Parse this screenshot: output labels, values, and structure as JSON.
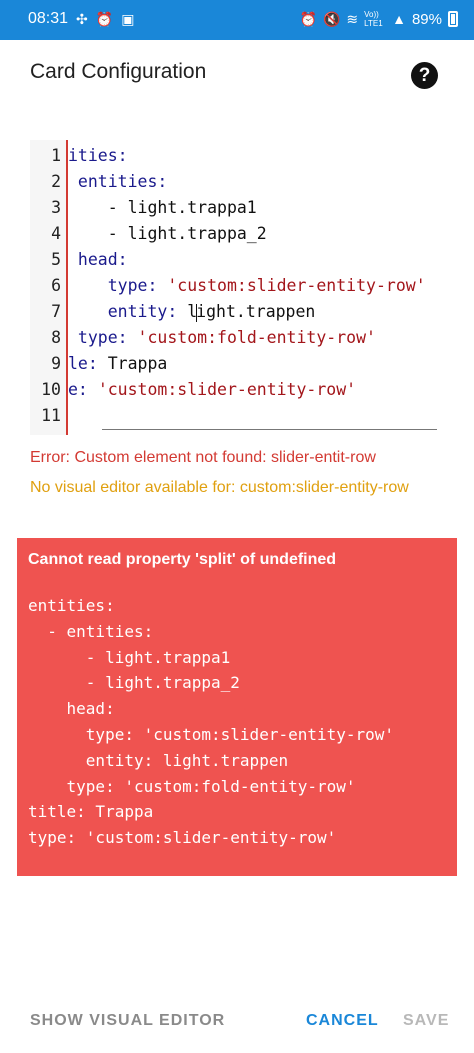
{
  "status_bar": {
    "time": "08:31",
    "battery": "89%",
    "left_icons": [
      "pinwheel-icon",
      "alarm-icon",
      "image-icon"
    ],
    "right_icons": [
      "alarm-icon",
      "mute-icon",
      "wifi-icon",
      "volte-icon",
      "signal-icon"
    ],
    "volte_text": "Vo)) LTE1"
  },
  "dialog": {
    "title": "Card Configuration",
    "help_icon": "help-icon"
  },
  "editor": {
    "line_numbers": [
      "1",
      "2",
      "3",
      "4",
      "5",
      "6",
      "7",
      "8",
      "9",
      "10",
      "11"
    ],
    "lines": [
      {
        "key": "ities:",
        "value": ""
      },
      {
        "key": " entities:",
        "value": ""
      },
      {
        "key": "    - light.trappa1",
        "value": ""
      },
      {
        "key": "    - light.trappa_2",
        "value": ""
      },
      {
        "key": " head:",
        "value": ""
      },
      {
        "key": "    type: ",
        "value": "'custom:slider-entity-row'"
      },
      {
        "key": "    entity: ",
        "value_pre": "l",
        "value_post": "ight.trappen"
      },
      {
        "key": " type: ",
        "value": "'custom:fold-entity-row'"
      },
      {
        "key": "le: ",
        "value": "Trappa"
      },
      {
        "key": "e: ",
        "value": "'custom:slider-entity-row'"
      },
      {
        "key": "",
        "value": ""
      }
    ]
  },
  "messages": {
    "error": "Error: Custom element not found: slider-entit-row",
    "warning": "No visual editor available for: custom:slider-entity-row"
  },
  "error_card": {
    "title": "Cannot read property 'split' of undefined",
    "yaml": "entities:\n  - entities:\n      - light.trappa1\n      - light.trappa_2\n    head:\n      type: 'custom:slider-entity-row'\n      entity: light.trappen\n    type: 'custom:fold-entity-row'\ntitle: Trappa\ntype: 'custom:slider-entity-row'"
  },
  "footer": {
    "show_visual_editor": "SHOW VISUAL EDITOR",
    "cancel": "CANCEL",
    "save": "SAVE"
  },
  "colors": {
    "accent": "#1a87d8",
    "error": "#d33a33",
    "warning": "#e0a010",
    "error_card_bg": "#ef5350"
  }
}
